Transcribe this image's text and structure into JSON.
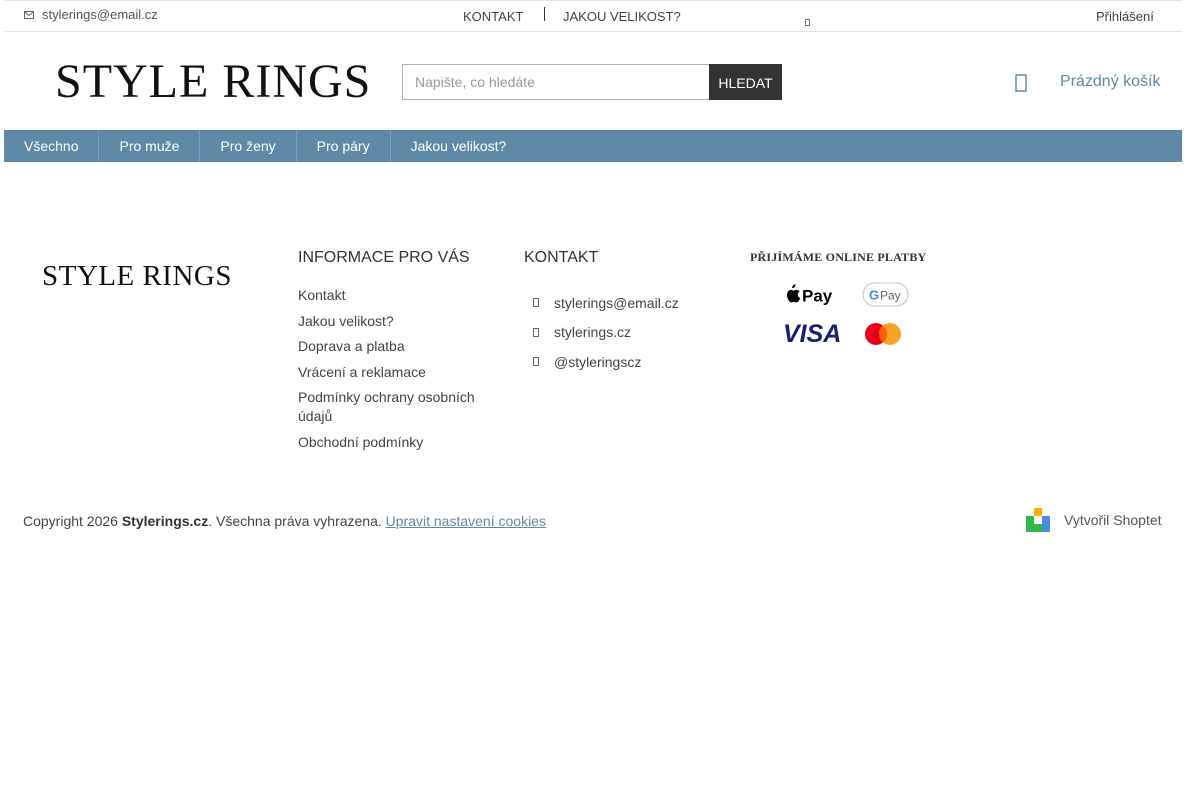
{
  "topbar": {
    "email": "stylerings@email.cz",
    "contact_link": "KONTAKT",
    "size_link": "JAKOU VELIKOST?",
    "login": "Přihlášení"
  },
  "header": {
    "logo": "STYLE RINGS",
    "search": {
      "placeholder": "Napište, co hledáte",
      "button": "HLEDAT"
    },
    "cart": "Prázdný košík"
  },
  "nav": {
    "items": [
      "Všechno",
      "Pro muže",
      "Pro ženy",
      "Pro páry",
      "Jakou velikost?"
    ]
  },
  "footer": {
    "logo": "STYLE RINGS",
    "info": {
      "title": "INFORMACE PRO VÁS",
      "links": [
        "Kontakt",
        "Jakou velikost?",
        "Doprava a platba",
        "Vrácení a reklamace",
        "Podmínky ochrany osobních údajů",
        "Obchodní podmínky"
      ]
    },
    "contact": {
      "title": "KONTAKT",
      "email": "stylerings@email.cz",
      "web": "stylerings.cz",
      "instagram": "@styleringscz"
    },
    "payments": {
      "title": "PŘIJÍMÁME ONLINE PLATBY",
      "methods": [
        "Pay",
        "G Pay",
        "VISA",
        "Mastercard"
      ],
      "apple_pay_label": "Pay",
      "gpay_g": "G",
      "gpay_pay": "Pay",
      "visa": "VISA"
    },
    "copyright_prefix": "Copyright 2026 ",
    "copyright_brand": "Stylerings.cz",
    "copyright_suffix": ". Všechna práva vyhrazena. ",
    "cookies_link": "Upravit nastavení cookies",
    "shoptet": "Vytvořil Shoptet"
  },
  "colors": {
    "brand_blue": "#6089a7",
    "search_button": "#333333",
    "visa_blue": "#1a1f71",
    "mastercard_red": "#eb001b",
    "mastercard_orange": "#f79e1b"
  },
  "icons": {
    "topbar_email": "envelope-icon",
    "cart": "cart-icon",
    "language": "language-chevron-icon",
    "contact_email": "envelope-icon",
    "contact_web": "globe-icon",
    "contact_instagram": "instagram-icon",
    "apple_pay": "apple-icon",
    "shoptet": "shoptet-logo-icon"
  }
}
